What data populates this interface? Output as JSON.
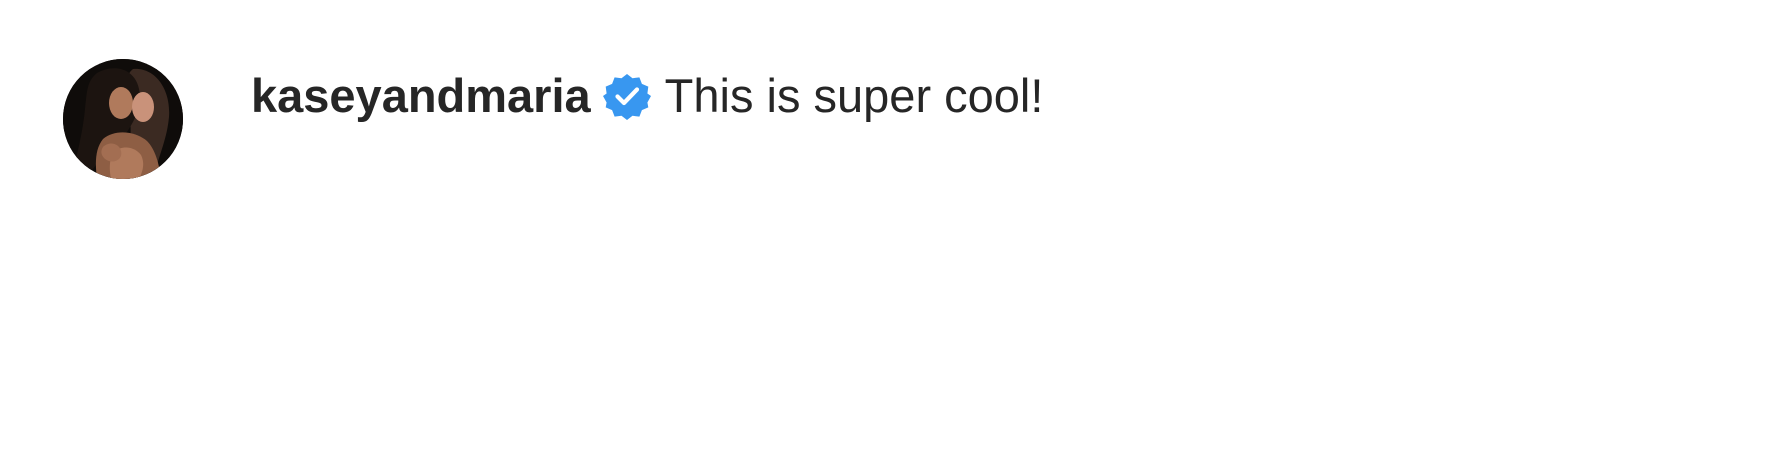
{
  "comment": {
    "username": "kaseyandmaria",
    "text": "This is super cool!",
    "verified": true,
    "verified_badge_icon": "verified-badge-icon",
    "avatar_icon": "profile-photo-avatar"
  },
  "colors": {
    "text": "#262626",
    "verified_blue": "#3897f0",
    "background": "#ffffff"
  }
}
